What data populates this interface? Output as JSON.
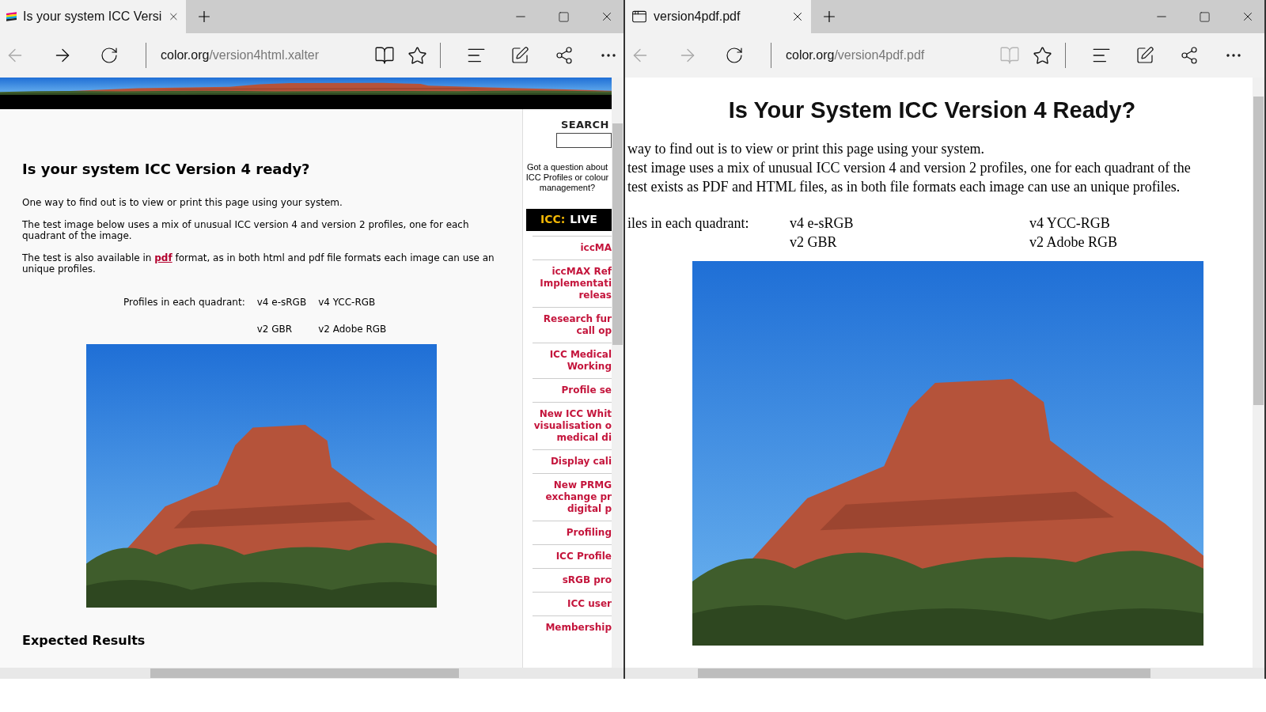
{
  "windows": [
    {
      "tab": {
        "title": "Is your system ICC Versi",
        "kind": "stripes"
      },
      "address": {
        "domain": "color.org",
        "path": "/version4html.xalter"
      },
      "nav": {
        "back_disabled": true,
        "forward_disabled": false
      },
      "reading_view_disabled": false,
      "page": {
        "kind": "html",
        "heading": "Is your system ICC Version 4 ready?",
        "paragraphs": [
          {
            "before": "One way to find out is to view or print this page using your system."
          },
          {
            "before": "The test image below uses a mix of unusual ICC version 4 and version 2 profiles, one for each quadrant of the image."
          },
          {
            "before": "The test is also available in ",
            "link": "pdf",
            "after": " format, as in both html and pdf file formats each image can use an unique profiles."
          }
        ],
        "profiles_label": "Profiles in each quadrant:",
        "profiles": [
          "v4 e-sRGB",
          "v4 YCC-RGB",
          "v2 GBR",
          "v2 Adobe RGB"
        ],
        "subheading": "Expected Results",
        "sidebar": {
          "search_label": "SEARCH",
          "question": "Got a question about ICC Profiles or colour management?",
          "banner_brand": "ICC:",
          "banner_text": "LIVE",
          "news": [
            [
              "iccMA"
            ],
            [
              "iccMAX Ref",
              "Implementati",
              "releas"
            ],
            [
              "Research fur",
              "call op"
            ],
            [
              "ICC Medical",
              "Working"
            ],
            [
              "Profile se"
            ],
            [
              "New ICC Whit",
              "visualisation o",
              "medical di"
            ],
            [
              "Display cali"
            ],
            [
              "New PRMG",
              "exchange pr",
              "digital p"
            ],
            [
              "Profiling"
            ],
            [
              "ICC Profile"
            ],
            [
              "sRGB pro"
            ],
            [
              "ICC user"
            ],
            [
              "Membership"
            ]
          ]
        }
      }
    },
    {
      "tab": {
        "title": "version4pdf.pdf",
        "kind": "window"
      },
      "address": {
        "domain": "color.org",
        "path": "/version4pdf.pdf"
      },
      "nav": {
        "back_disabled": true,
        "forward_disabled": true
      },
      "reading_view_disabled": true,
      "page": {
        "kind": "pdf",
        "heading": "Is Your System ICC Version 4 Ready?",
        "lines": [
          "way to find out is to view or print this page using your system.",
          "test image uses a mix of unusual ICC version 4 and version 2 profiles, one for each quadrant of the",
          "test exists as PDF and HTML files, as in both file formats each image can use an unique profiles."
        ],
        "profiles_label": "iles in each quadrant:",
        "profiles": [
          "v4 e-sRGB",
          "v4 YCC-RGB",
          "v2 GBR",
          "v2 Adobe RGB"
        ]
      }
    }
  ]
}
